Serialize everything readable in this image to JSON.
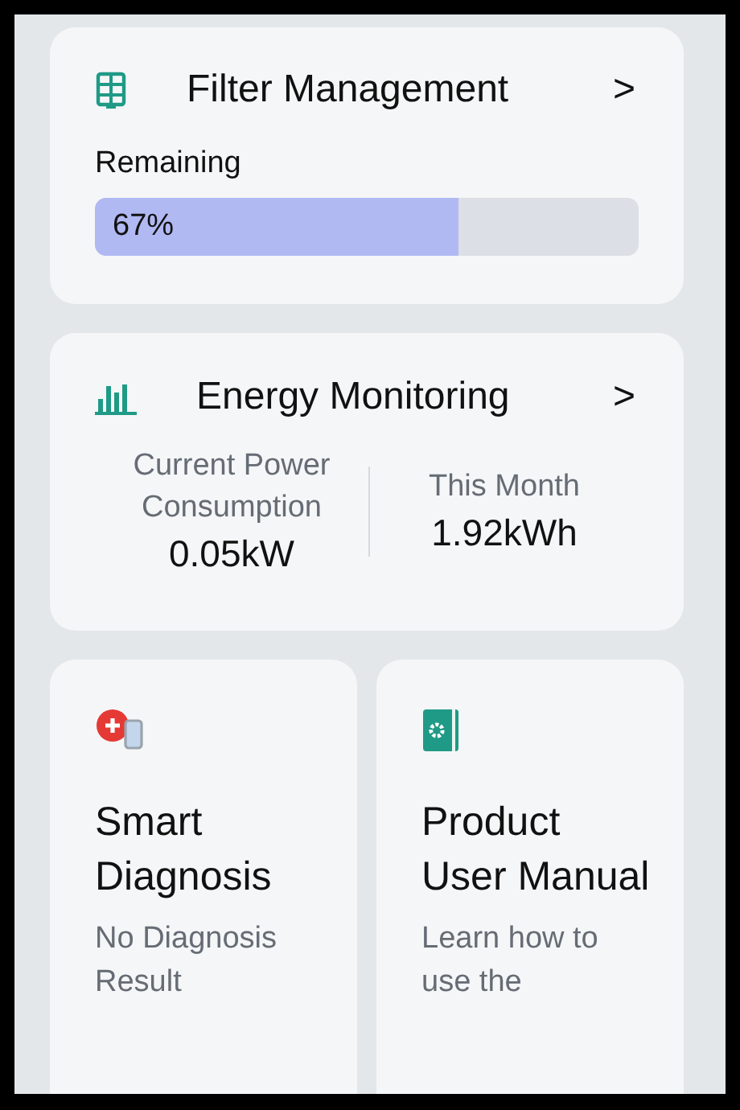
{
  "filter_card": {
    "title": "Filter Management",
    "chevron": ">",
    "remaining_label": "Remaining",
    "level": 0.67,
    "reading": "67%"
  },
  "energy_card": {
    "title": "Energy Monitoring",
    "chevron": ">",
    "stats": [
      {
        "label": "Current Power Consumption",
        "value": "0.05kW"
      },
      {
        "label": "This Month",
        "value": "1.92kWh"
      }
    ]
  },
  "tiles": [
    {
      "kind": "diagnosis",
      "title": "Smart Diagnosis",
      "subtitle": "No Diagnosis Result"
    },
    {
      "kind": "manual",
      "title": "Product User Manual",
      "subtitle": "Learn how to use the"
    }
  ]
}
